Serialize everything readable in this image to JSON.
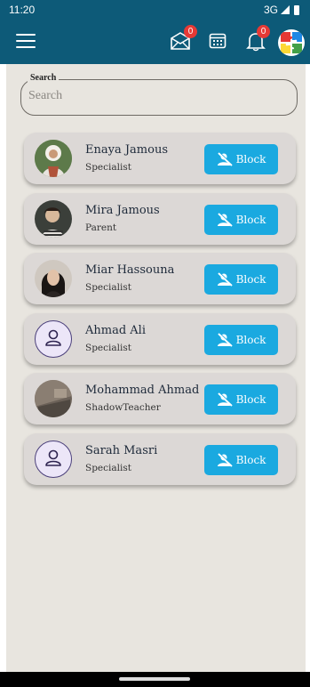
{
  "status_bar": {
    "time": "11:20",
    "network": "3G"
  },
  "app_bar": {
    "menu_icon": "menu-icon",
    "messages_badge": "0",
    "notifications_badge": "0"
  },
  "search": {
    "legend": "Search",
    "placeholder": "Search",
    "value": ""
  },
  "users": [
    {
      "name": "Enaya Jamous",
      "role": "Specialist",
      "block_label": "Block",
      "avatar": "photo"
    },
    {
      "name": "Mira Jamous",
      "role": "Parent",
      "block_label": "Block",
      "avatar": "photo"
    },
    {
      "name": "Miar Hassouna",
      "role": "Specialist",
      "block_label": "Block",
      "avatar": "photo"
    },
    {
      "name": "Ahmad Ali",
      "role": "Specialist",
      "block_label": "Block",
      "avatar": "person-icon"
    },
    {
      "name": "Mohammad Ahmad",
      "role": "ShadowTeacher",
      "block_label": "Block",
      "avatar": "photo"
    },
    {
      "name": "Sarah Masri",
      "role": "Specialist",
      "block_label": "Block",
      "avatar": "person-icon"
    }
  ],
  "colors": {
    "app_bar": "#0d5a78",
    "block_button": "#1aa9e0",
    "card": "#dcd8d6",
    "background": "#e8e5df",
    "badge": "#e53935"
  }
}
